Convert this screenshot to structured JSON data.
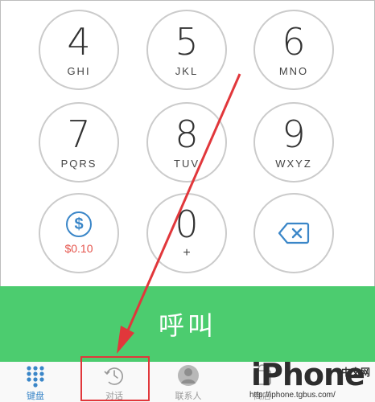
{
  "keypad": {
    "keys": [
      {
        "digit": "4",
        "letters": "GHI"
      },
      {
        "digit": "5",
        "letters": "JKL"
      },
      {
        "digit": "6",
        "letters": "MNO"
      },
      {
        "digit": "7",
        "letters": "PQRS"
      },
      {
        "digit": "8",
        "letters": "TUV"
      },
      {
        "digit": "9",
        "letters": "WXYZ"
      },
      {
        "digit": "0",
        "letters": "+"
      }
    ],
    "credit": {
      "symbol": "$",
      "amount": "$0.10"
    },
    "backspace_icon": "backspace-icon"
  },
  "call_button": {
    "label": "呼叫"
  },
  "tabbar": {
    "tabs": [
      {
        "label": "键盘",
        "icon": "keypad-grid-icon",
        "active": true
      },
      {
        "label": "对话",
        "icon": "recents-clock-icon",
        "active": false
      },
      {
        "label": "联系人",
        "icon": "contact-person-icon",
        "active": false
      },
      {
        "label": "商店",
        "icon": "store-icon",
        "active": false
      }
    ]
  },
  "watermark": {
    "brand": "iPhone",
    "sub": "中文网",
    "url": "http://iphone.tgbus.com/"
  },
  "colors": {
    "accent": "#4ccc6f",
    "active_tab": "#3a86c8",
    "highlight": "#e1373b"
  }
}
